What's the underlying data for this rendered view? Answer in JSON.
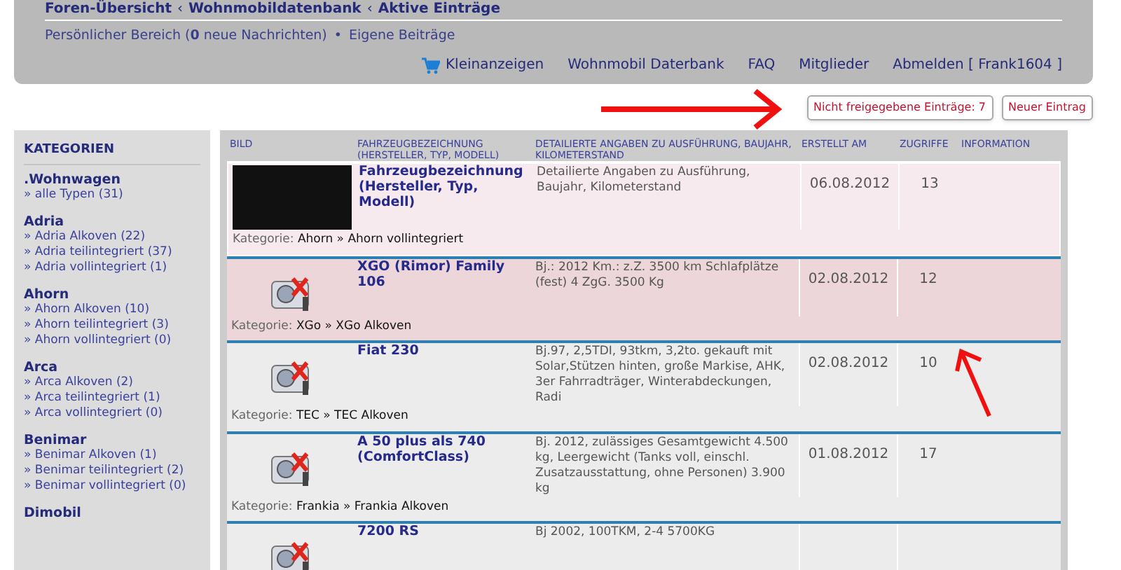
{
  "breadcrumb": [
    "Foren-Übersicht",
    "Wohnmobildatenbank",
    "Aktive Einträge"
  ],
  "breadcrumb_separator": "‹",
  "user_bar": {
    "text": "Persönlicher Bereich (**0** neue Nachrichten)",
    "separator": "•",
    "link": "Eigene Beiträge"
  },
  "nav": [
    {
      "label": "Kleinanzeigen"
    },
    {
      "label": "Wohnmobil Daterbank"
    },
    {
      "label": "FAQ"
    },
    {
      "label": "Mitglieder"
    },
    {
      "label": "Abmelden [ Frank1604 ]"
    }
  ],
  "buttons": [
    "Nicht freigegebene Einträge: 7",
    "Neuer Eintrag"
  ],
  "sidebar": {
    "title": "KATEGORIEN",
    "groups": [
      {
        "name": ".Wohnwagen",
        "items": [
          "» alle Typen (31)"
        ]
      },
      {
        "name": "Adria",
        "items": [
          "» Adria Alkoven (22)",
          "» Adria teilintegriert (37)",
          "» Adria vollintegriert (1)"
        ]
      },
      {
        "name": "Ahorn",
        "items": [
          "» Ahorn Alkoven (10)",
          "» Ahorn teilintegriert (3)",
          "» Ahorn vollintegriert (0)"
        ]
      },
      {
        "name": "Arca",
        "items": [
          "» Arca Alkoven (2)",
          "» Arca teilintegriert (1)",
          "» Arca vollintegriert (0)"
        ]
      },
      {
        "name": "Benimar",
        "items": [
          "» Benimar Alkoven (1)",
          "» Benimar teilintegriert (2)",
          "» Benimar vollintegriert (0)"
        ]
      },
      {
        "name": "Dimobil"
      }
    ]
  },
  "table": {
    "columns": [
      "BILD",
      "FAHRZEUGBEZEICHNUNG (HERSTELLER, TYP, MODELL)",
      "DETAILIERTE ANGABEN ZU AUSFÜHRUNG, BAUJAHR, KILOMETERSTAND",
      "ERSTELLT AM",
      "ZUGRIFFE",
      "INFORMATION"
    ],
    "rows": [
      {
        "kind": "sample",
        "name": "Fahrzeugbezeichnung (Hersteller, Typ, Modell)",
        "details": "Detailierte Angaben zu Ausführung, Baujahr, Kilometerstand",
        "date": "06.08.2012",
        "views": "13",
        "category_label": "Kategorie:",
        "category": "Ahorn » Ahorn vollintegriert"
      },
      {
        "kind": "pending",
        "name": "XGO (Rimor) Family 106",
        "details": "Bj.: 2012 Km.: z.Z. 3500 km Schlafplätze (fest) 4 ZgG. 3500 Kg",
        "date": "02.08.2012",
        "views": "12",
        "category_label": "Kategorie:",
        "category": "XGo » XGo Alkoven"
      },
      {
        "kind": "normal",
        "name": "Fiat 230",
        "details": "Bj.97, 2,5TDI, 93tkm, 3,2to. gekauft mit Solar,Stützen hinten, große Markise, AHK, 3er Fahrradträger, Winterabdeckungen, Radi",
        "date": "02.08.2012",
        "views": "10",
        "category_label": "Kategorie:",
        "category": "TEC » TEC Alkoven"
      },
      {
        "kind": "normal",
        "name": "A 50 plus als 740 (ComfortClass)",
        "details": "Bj. 2012, zulässiges Gesamtgewicht 4.500 kg, Leergewicht (Tanks voll, einschl. Zusatzausstattung, ohne Personen) 3.900 kg",
        "date": "01.08.2012",
        "views": "17",
        "category_label": "Kategorie:",
        "category": "Frankia » Frankia Alkoven"
      },
      {
        "kind": "normal",
        "name": "7200 RS",
        "details": "Bj 2002, 100TKM, 2-4 5700KG"
      }
    ]
  }
}
